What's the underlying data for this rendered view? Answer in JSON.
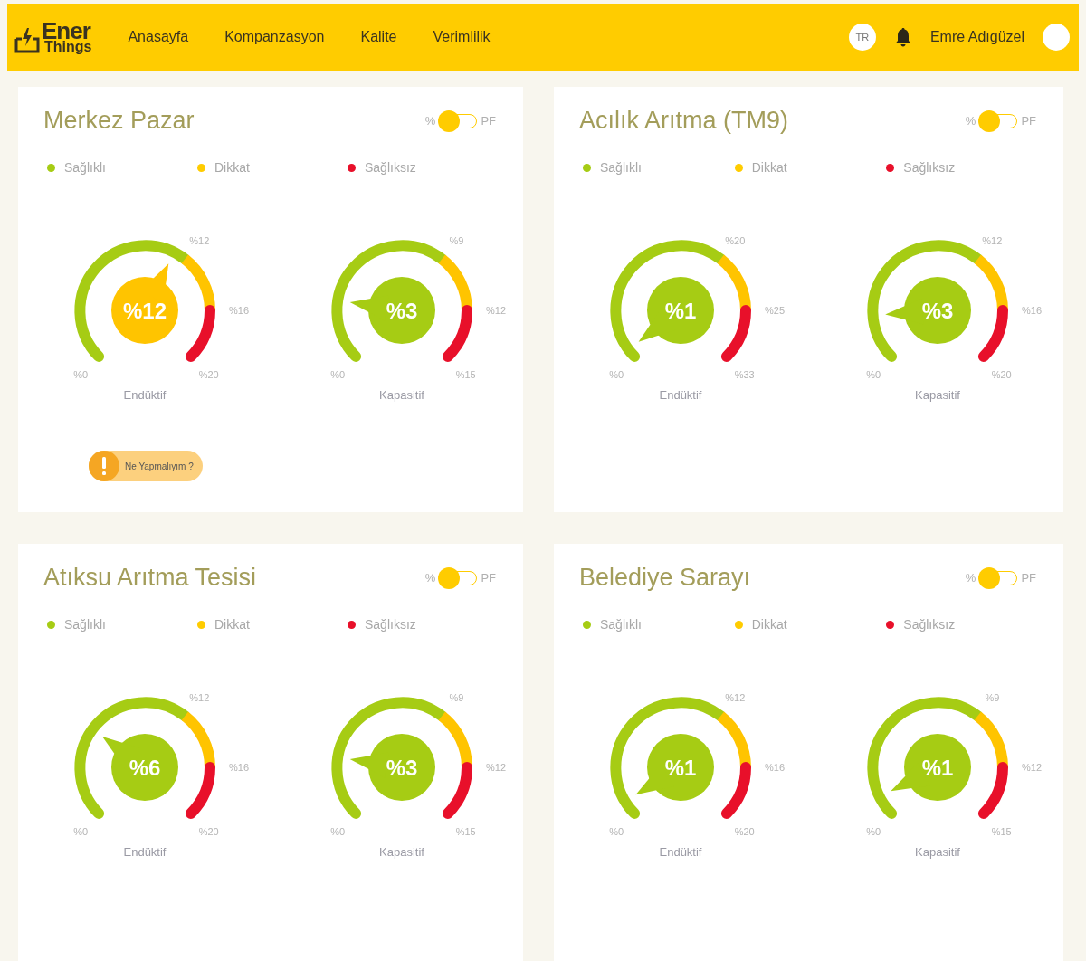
{
  "header": {
    "logo": {
      "line_1": "Ener",
      "line_2": "Things"
    },
    "nav": [
      {
        "label": "Anasayfa",
        "selected": false
      },
      {
        "label": "Kompanzasyon",
        "selected": false
      },
      {
        "label": "Kalite",
        "selected": false
      },
      {
        "label": "Verimlilik",
        "selected": false
      }
    ],
    "language": "TR",
    "user_name": "Emre Adıgüzel"
  },
  "cards": [
    {
      "title": "Merkez Pazar",
      "toggle": {
        "left": "%",
        "right": "PF",
        "on": false
      },
      "legend": [
        {
          "label": "Sağlıklı",
          "color": "#a6cc14"
        },
        {
          "label": "Dikkat",
          "color": "#ffcc00"
        },
        {
          "label": "Sağlıksız",
          "color": "#e8102a"
        }
      ],
      "gauges": [
        {
          "label": "Endüktif",
          "value": "%12",
          "color": "#ffc400",
          "ticks": [
            "%0",
            "%12",
            "%16",
            "%20"
          ]
        },
        {
          "label": "Kapasitif",
          "value": "%3",
          "color": "#a6cc14",
          "ticks": [
            "%0",
            "%9",
            "%12",
            "%15"
          ]
        }
      ],
      "alert": "Ne Yapmalıyım ?"
    },
    {
      "title": "Acılık Arıtma (TM9)",
      "toggle": {
        "left": "%",
        "right": "PF",
        "on": false
      },
      "legend": [
        {
          "label": "Sağlıklı",
          "color": "#a6cc14"
        },
        {
          "label": "Dikkat",
          "color": "#ffcc00"
        },
        {
          "label": "Sağlıksız",
          "color": "#e8102a"
        }
      ],
      "gauges": [
        {
          "label": "Endüktif",
          "value": "%1",
          "color": "#a6cc14",
          "ticks": [
            "%0",
            "%20",
            "%25",
            "%33"
          ]
        },
        {
          "label": "Kapasitif",
          "value": "%3",
          "color": "#a6cc14",
          "ticks": [
            "%0",
            "%12",
            "%16",
            "%20"
          ]
        }
      ]
    },
    {
      "title": "Atıksu Arıtma Tesisi",
      "toggle": {
        "left": "%",
        "right": "PF",
        "on": false
      },
      "legend": [
        {
          "label": "Sağlıklı",
          "color": "#a6cc14"
        },
        {
          "label": "Dikkat",
          "color": "#ffcc00"
        },
        {
          "label": "Sağlıksız",
          "color": "#e8102a"
        }
      ],
      "gauges": [
        {
          "label": "Endüktif",
          "value": "%6",
          "color": "#a6cc14",
          "ticks": [
            "%0",
            "%12",
            "%16",
            "%20"
          ]
        },
        {
          "label": "Kapasitif",
          "value": "%3",
          "color": "#a6cc14",
          "ticks": [
            "%0",
            "%9",
            "%12",
            "%15"
          ]
        }
      ]
    },
    {
      "title": "Belediye Sarayı",
      "toggle": {
        "left": "%",
        "right": "PF",
        "on": false
      },
      "legend": [
        {
          "label": "Sağlıklı",
          "color": "#a6cc14"
        },
        {
          "label": "Dikkat",
          "color": "#ffcc00"
        },
        {
          "label": "Sağlıksız",
          "color": "#e8102a"
        }
      ],
      "gauges": [
        {
          "label": "Endüktif",
          "value": "%1",
          "color": "#a6cc14",
          "ticks": [
            "%0",
            "%12",
            "%16",
            "%20"
          ]
        },
        {
          "label": "Kapasitif",
          "value": "%1",
          "color": "#a6cc14",
          "ticks": [
            "%0",
            "%9",
            "%12",
            "%15"
          ]
        }
      ]
    }
  ]
}
